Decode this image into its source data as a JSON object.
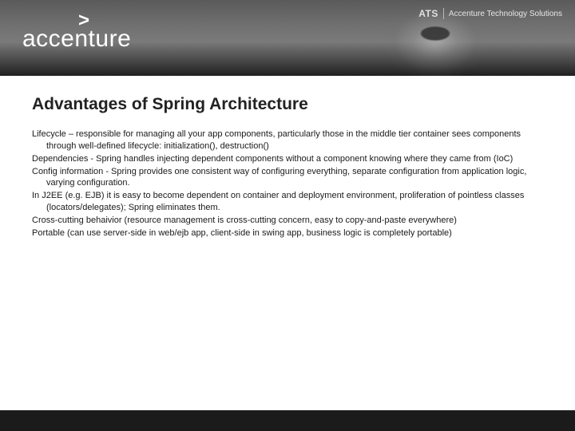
{
  "header": {
    "logo_caret": ">",
    "logo_text": "accenture",
    "ats_badge": "ATS",
    "ats_text": "Accenture Technology Solutions"
  },
  "content": {
    "title": "Advantages of Spring Architecture",
    "paragraphs": [
      "Lifecycle – responsible for managing all your app components, particularly those in the middle tier container sees components through well-defined lifecycle: initialization(), destruction()",
      "Dependencies - Spring handles injecting dependent components without a component knowing where they came from (IoC)",
      "Config information - Spring provides one consistent way of configuring everything, separate configuration from application logic, varying configuration.",
      "In J2EE (e.g. EJB) it is easy to become dependent on container and deployment environment, proliferation of pointless classes (locators/delegates); Spring eliminates them.",
      "Cross-cutting behaivior (resource management is cross-cutting concern, easy to copy-and-paste everywhere)",
      "Portable (can use server-side in web/ejb app, client-side in swing app, business logic is completely portable)"
    ]
  }
}
